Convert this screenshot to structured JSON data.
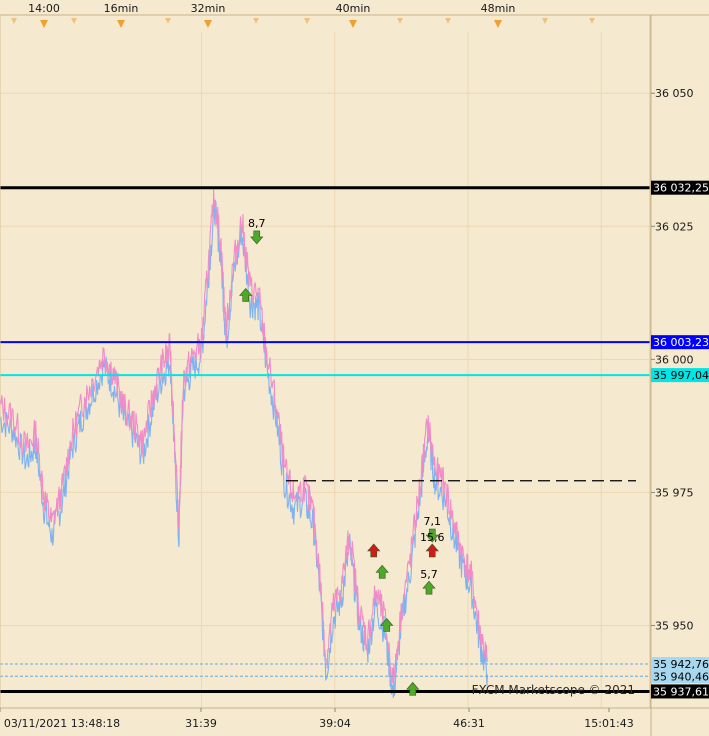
{
  "chart_data": {
    "type": "line",
    "instrument_note": "",
    "watermark": "FXCM Marketscope © 2021",
    "colors": {
      "background": "#f5e9cf",
      "grid": "#ecd9b0",
      "price_up": "#f08cc8",
      "price_down": "#7fb3f0",
      "level_black": "#000000",
      "level_blue": "#0000ff",
      "level_cyan": "#00e5e5",
      "signal_buy": "#4fa82b",
      "signal_sell": "#d11a1a"
    },
    "top_time_labels": [
      "14:00",
      "16min",
      "32min",
      "40min",
      "48min"
    ],
    "bottom_time_labels": [
      "03/11/2021 13:48:18",
      "31:39",
      "39:04",
      "46:31",
      "15:01:43"
    ],
    "y_axis": {
      "ylim": [
        35934.5,
        36061.5
      ],
      "ticks": [
        {
          "value": 36050,
          "label": "36 050"
        },
        {
          "value": 36025,
          "label": "36 025"
        },
        {
          "value": 36000,
          "label": "36 000"
        },
        {
          "value": 35975,
          "label": "35 975"
        },
        {
          "value": 35950,
          "label": "35 950"
        }
      ]
    },
    "levels": [
      {
        "name": "resistance-high",
        "value": 36032.25,
        "label": "36 032,25",
        "style": "solid-thick",
        "color": "#000000",
        "label_bg": "#000000",
        "label_fg": "#ffffff"
      },
      {
        "name": "blue-level",
        "value": 36003.23,
        "label": "36 003,23",
        "style": "solid",
        "color": "#0000ff",
        "label_bg": "#0000ff",
        "label_fg": "#ffffff"
      },
      {
        "name": "cyan-level",
        "value": 35997.04,
        "label": "35 997,04",
        "style": "solid",
        "color": "#00e5e5",
        "label_bg": "#00e5e5",
        "label_fg": "#000000"
      },
      {
        "name": "ask-level",
        "value": 35942.76,
        "label": "35 942,76",
        "style": "dotted",
        "color": "#66aadd",
        "label_bg": "#a8d8f0",
        "label_fg": "#000000"
      },
      {
        "name": "bid-level",
        "value": 35940.46,
        "label": "35 940,46",
        "style": "dotted",
        "color": "#66aadd",
        "label_bg": "#a8d8f0",
        "label_fg": "#000000"
      },
      {
        "name": "support-low",
        "value": 35937.61,
        "label": "35 937,61",
        "style": "solid-thick",
        "color": "#000000",
        "label_bg": "#000000",
        "label_fg": "#ffffff"
      }
    ],
    "dashed_level": {
      "value": 35977.2,
      "x_start": 0.44
    },
    "price_series": {
      "x_range": [
        0,
        1
      ],
      "points": [
        [
          0.0,
          35990
        ],
        [
          0.02,
          35988
        ],
        [
          0.04,
          35982
        ],
        [
          0.055,
          35985
        ],
        [
          0.068,
          35973
        ],
        [
          0.08,
          35968
        ],
        [
          0.095,
          35974
        ],
        [
          0.11,
          35984
        ],
        [
          0.125,
          35990
        ],
        [
          0.14,
          35994
        ],
        [
          0.16,
          36000
        ],
        [
          0.175,
          35996
        ],
        [
          0.19,
          35990
        ],
        [
          0.205,
          35987
        ],
        [
          0.22,
          35983
        ],
        [
          0.235,
          35992
        ],
        [
          0.25,
          35998
        ],
        [
          0.262,
          36001
        ],
        [
          0.268,
          35985
        ],
        [
          0.275,
          35967
        ],
        [
          0.282,
          35995
        ],
        [
          0.295,
          35999
        ],
        [
          0.31,
          36002
        ],
        [
          0.32,
          36016
        ],
        [
          0.33,
          36030
        ],
        [
          0.34,
          36020
        ],
        [
          0.348,
          36004
        ],
        [
          0.358,
          36016
        ],
        [
          0.372,
          36025
        ],
        [
          0.385,
          36012
        ],
        [
          0.398,
          36011
        ],
        [
          0.41,
          36000
        ],
        [
          0.425,
          35990
        ],
        [
          0.438,
          35978
        ],
        [
          0.452,
          35973
        ],
        [
          0.468,
          35975
        ],
        [
          0.482,
          35970
        ],
        [
          0.492,
          35958
        ],
        [
          0.502,
          35942
        ],
        [
          0.512,
          35952
        ],
        [
          0.525,
          35956
        ],
        [
          0.538,
          35966
        ],
        [
          0.552,
          35952
        ],
        [
          0.565,
          35946
        ],
        [
          0.578,
          35955
        ],
        [
          0.592,
          35950
        ],
        [
          0.605,
          35938
        ],
        [
          0.618,
          35952
        ],
        [
          0.632,
          35962
        ],
        [
          0.645,
          35974
        ],
        [
          0.658,
          35987
        ],
        [
          0.67,
          35978
        ],
        [
          0.685,
          35975
        ],
        [
          0.698,
          35968
        ],
        [
          0.712,
          35962
        ],
        [
          0.725,
          35958
        ],
        [
          0.738,
          35948
        ],
        [
          0.75,
          35942
        ]
      ]
    },
    "signals": [
      {
        "type": "sell",
        "x": 0.395,
        "value": 36023,
        "label": "8,7"
      },
      {
        "type": "buy",
        "x": 0.378,
        "value": 36012,
        "label": ""
      },
      {
        "type": "sell-red",
        "x": 0.575,
        "value": 35964,
        "label": ""
      },
      {
        "type": "buy",
        "x": 0.588,
        "value": 35960,
        "label": ""
      },
      {
        "type": "buy",
        "x": 0.595,
        "value": 35950,
        "label": ""
      },
      {
        "type": "buy",
        "x": 0.635,
        "value": 35938,
        "label": ""
      },
      {
        "type": "sell",
        "x": 0.665,
        "value": 35967,
        "label": "7,1"
      },
      {
        "type": "sell-red",
        "x": 0.665,
        "value": 35964,
        "label": "15,6"
      },
      {
        "type": "buy",
        "x": 0.66,
        "value": 35957,
        "label": "5,7"
      }
    ],
    "grid": true
  }
}
